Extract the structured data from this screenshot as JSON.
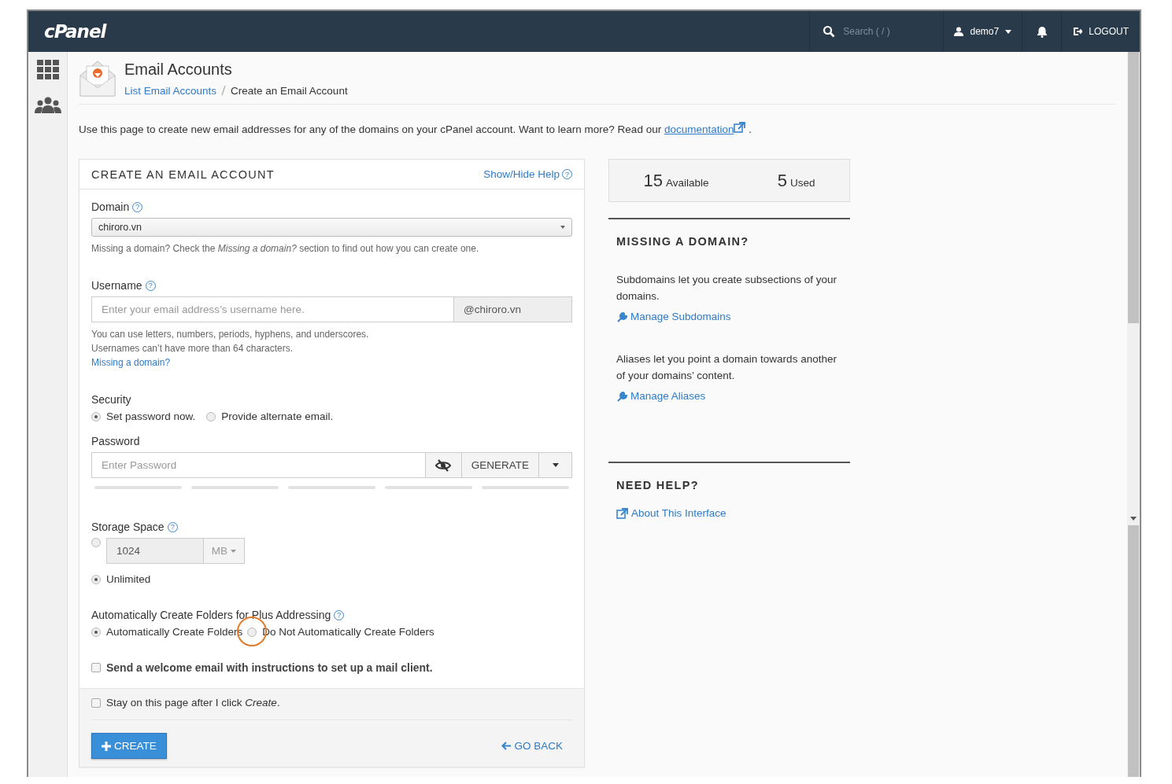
{
  "header": {
    "logo": "cPanel",
    "search": {
      "placeholder": "Search ( / )"
    },
    "user": "demo7",
    "logout": "LOGOUT"
  },
  "page": {
    "title": "Email Accounts",
    "breadcrumb": [
      {
        "label": "List Email Accounts",
        "kind": "link"
      },
      {
        "label": "Create an Email Account",
        "kind": "current"
      }
    ],
    "intro": {
      "text": "Use this page to create new email addresses for any of the domains on your cPanel account. Want to learn more? Read our ",
      "link": "documentation",
      "after": "."
    }
  },
  "form": {
    "title": "CREATE AN EMAIL ACCOUNT",
    "help_link": "Show/Hide Help",
    "help_icon": "?",
    "domain": {
      "label": "Domain",
      "help_icon": "?",
      "value": "chiroro.vn",
      "hint": "Missing a domain? Check the *Missing a domain?* section to find out how you can create one."
    },
    "username": {
      "label": "Username",
      "help_icon": "?",
      "placeholder": "Enter your email address’s username here.",
      "suffix": "@chiroro.vn",
      "hints": [
        "You can use letters, numbers, periods, hyphens, and underscores.",
        "Usernames can’t have more than 64 characters."
      ],
      "link": "Missing a domain?"
    },
    "security": {
      "label": "Security",
      "options": [
        {
          "label": "Set password now.",
          "selected": true
        },
        {
          "label": "Provide alternate email.",
          "selected": false
        }
      ]
    },
    "password": {
      "label": "Password",
      "placeholder": "Enter Password",
      "generate": "GENERATE",
      "strength": {
        "level": 0
      }
    },
    "storage": {
      "label": "Storage Space",
      "help_icon": "?",
      "options": [
        {
          "kind": "quota",
          "value": "1024",
          "unit": "MB",
          "selected": false
        },
        {
          "kind": "plain",
          "label": "Unlimited",
          "selected": true
        }
      ]
    },
    "plus": {
      "label": "Automatically Create Folders for Plus Addressing",
      "help_icon": "?",
      "options": [
        {
          "label": "Automatically Create Folders",
          "selected": true,
          "highlighted": false
        },
        {
          "label": "Do Not Automatically Create Folders",
          "selected": false,
          "highlighted": true
        }
      ]
    },
    "welcome": {
      "label": "Send a welcome email with instructions to set up a mail client.",
      "checked": false
    },
    "stay": {
      "label": "Stay on this page after I click *Create*.",
      "checked": false
    },
    "create": "CREATE",
    "back": "GO BACK"
  },
  "stats": [
    {
      "value": "15",
      "label": "Available"
    },
    {
      "value": "5",
      "label": "Used"
    }
  ],
  "missing": {
    "title": "MISSING A DOMAIN?",
    "blocks": [
      {
        "text": "Subdomains let you create subsections of your domains.",
        "link": "Manage Subdomains"
      },
      {
        "text": "Aliases let you point a domain towards another of your domains’ content.",
        "link": "Manage Aliases"
      }
    ]
  },
  "help": {
    "title": "NEED HELP?",
    "link": "About This Interface"
  }
}
